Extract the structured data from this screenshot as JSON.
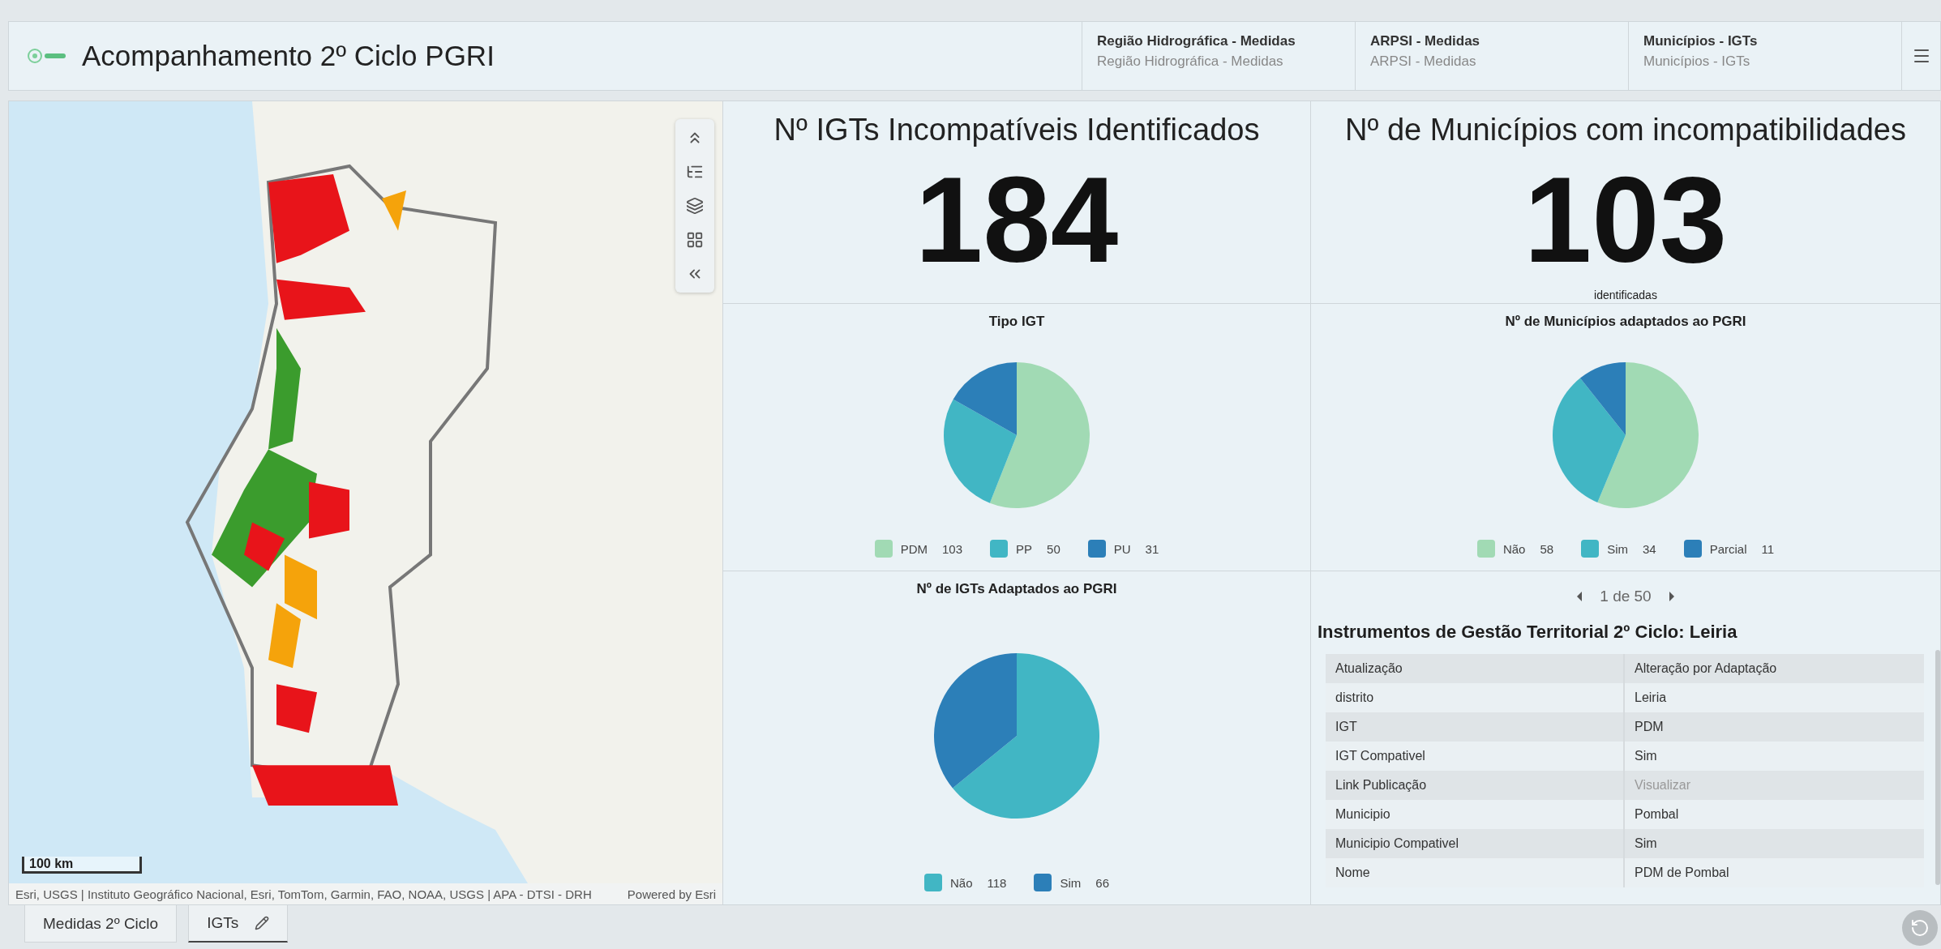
{
  "header": {
    "title": "Acompanhamento 2º Ciclo PGRI",
    "nav": [
      {
        "title": "Região Hidrográfica - Medidas",
        "subtitle": "Região Hidrográfica - Medidas"
      },
      {
        "title": "ARPSI - Medidas",
        "subtitle": "ARPSI - Medidas"
      },
      {
        "title": "Municípios - IGTs",
        "subtitle": "Municípios - IGTs"
      }
    ]
  },
  "map": {
    "scale": "100 km",
    "attribution": "Esri, USGS | Instituto Geográfico Nacional, Esri, TomTom, Garmin, FAO, NOAA, USGS | APA - DTSI - DRH",
    "powered_by": "Powered by Esri"
  },
  "kpis": [
    {
      "title": "Nº IGTs Incompatíveis Identificados",
      "value": "184"
    },
    {
      "title": "Nº de Municípios com incompatibilidades",
      "value": "103",
      "caption": "identificadas"
    }
  ],
  "pies": [
    {
      "chart_data": {
        "type": "pie",
        "title": "Tipo IGT",
        "categories": [
          "PDM",
          "PP",
          "PU"
        ],
        "values": [
          56,
          27.2,
          16.8
        ]
      },
      "legend": [
        {
          "count": "103",
          "color": "#a1dab4"
        },
        {
          "count": "50",
          "color": "#41b6c4"
        },
        {
          "count": "31",
          "color": "#2c7fb8"
        }
      ]
    },
    {
      "chart_data": {
        "type": "pie",
        "title": "Nº de Municípios adaptados ao PGRI",
        "categories": [
          "Não",
          "Sim",
          "Parcial"
        ],
        "values": [
          56.3,
          33,
          10.7
        ]
      },
      "legend": [
        {
          "count": "58",
          "color": "#a1dab4"
        },
        {
          "count": "34",
          "color": "#41b6c4"
        },
        {
          "count": "11",
          "color": "#2c7fb8"
        }
      ]
    },
    {
      "chart_data": {
        "type": "pie",
        "title": "Nº de IGTs Adaptados ao PGRI",
        "categories": [
          "Não",
          "Sim"
        ],
        "values": [
          64.1,
          35.9
        ]
      },
      "legend": [
        {
          "count": "118",
          "color": "#41b6c4"
        },
        {
          "count": "66",
          "color": "#2c7fb8"
        }
      ]
    }
  ],
  "details": {
    "pager": "1 de 50",
    "title": "Instrumentos de Gestão Territorial 2º Ciclo: Leiria",
    "rows": [
      {
        "field": "Atualização",
        "value": "Alteração por Adaptação",
        "kind": "text"
      },
      {
        "field": "distrito",
        "value": "Leiria",
        "kind": "text"
      },
      {
        "field": "IGT",
        "value": "PDM",
        "kind": "text"
      },
      {
        "field": "IGT Compativel",
        "value": "Sim",
        "kind": "text"
      },
      {
        "field": "Link Publicação",
        "value": "Visualizar",
        "kind": "link"
      },
      {
        "field": "Municipio",
        "value": "Pombal",
        "kind": "text"
      },
      {
        "field": "Municipio Compativel",
        "value": "Sim",
        "kind": "text"
      },
      {
        "field": "Nome",
        "value": "PDM de Pombal",
        "kind": "text"
      }
    ]
  },
  "tabs": [
    {
      "label": "Medidas 2º Ciclo",
      "selected": false,
      "editable": false
    },
    {
      "label": "IGTs",
      "selected": true,
      "editable": true
    }
  ]
}
